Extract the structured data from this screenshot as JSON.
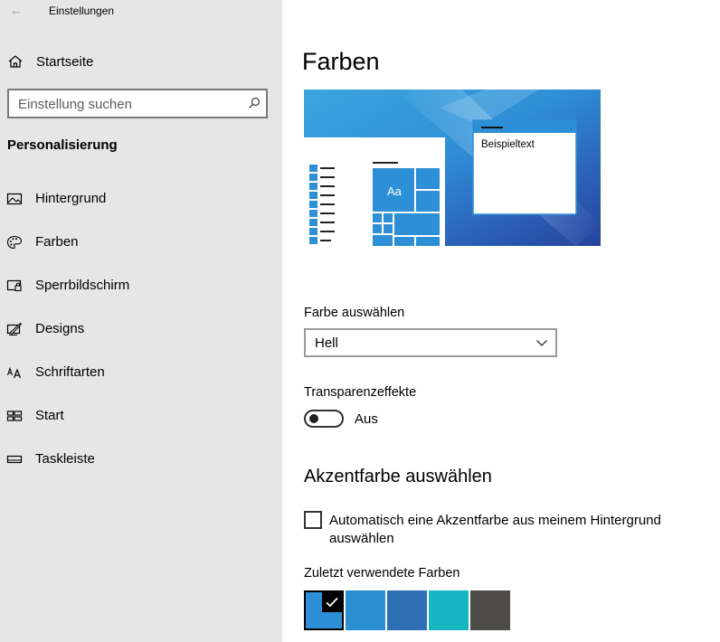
{
  "window": {
    "title": "Einstellungen"
  },
  "sidebar": {
    "home_label": "Startseite",
    "search_placeholder": "Einstellung suchen",
    "section_title": "Personalisierung",
    "items": [
      {
        "label": "Hintergrund",
        "icon": "image-icon"
      },
      {
        "label": "Farben",
        "icon": "palette-icon"
      },
      {
        "label": "Sperrbildschirm",
        "icon": "lock-screen-icon"
      },
      {
        "label": "Designs",
        "icon": "designs-icon"
      },
      {
        "label": "Schriftarten",
        "icon": "fonts-icon"
      },
      {
        "label": "Start",
        "icon": "start-icon"
      },
      {
        "label": "Taskleiste",
        "icon": "taskbar-icon"
      }
    ]
  },
  "main": {
    "title": "Farben",
    "preview": {
      "sample_text": "Beispieltext",
      "tile_text": "Aa"
    },
    "color_select": {
      "label": "Farbe auswählen",
      "value": "Hell"
    },
    "transparency": {
      "label": "Transparenzeffekte",
      "state_label": "Aus",
      "on": false
    },
    "accent": {
      "title": "Akzentfarbe auswählen",
      "auto_checkbox_label": "Automatisch eine Akzentfarbe aus meinem Hintergrund auswählen",
      "auto_checked": false,
      "recent_label": "Zuletzt verwendete Farben",
      "recent_colors": [
        "#2d8fd5",
        "#2b8ed3",
        "#2f6fb6",
        "#18b6c4",
        "#4d4c48"
      ],
      "selected_index": 0
    }
  },
  "colors": {
    "accent": "#2d8fd5",
    "sidebar_bg": "#e6e6e6"
  }
}
